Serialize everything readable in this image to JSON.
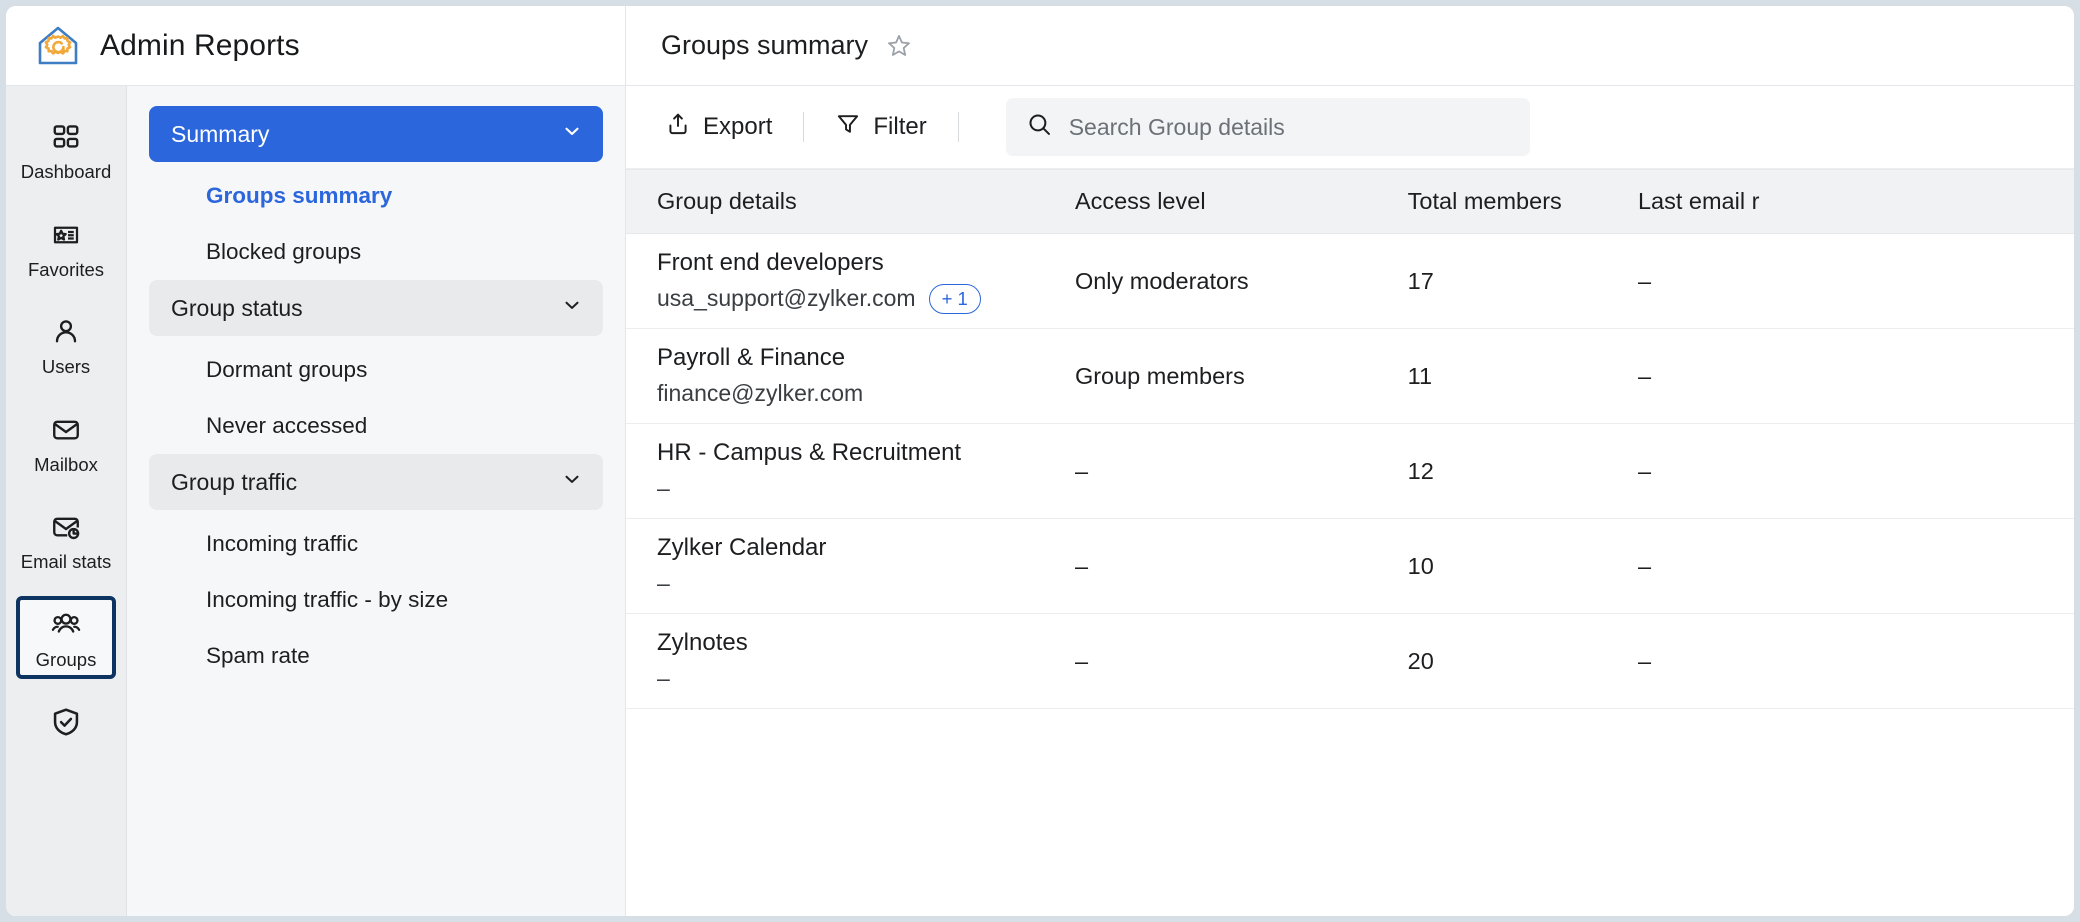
{
  "app": {
    "title": "Admin Reports",
    "logo_icon": "house-gear-icon",
    "brand_blue": "#3C7DC4",
    "brand_orange": "#F2A93B",
    "accent_blue": "#2B66DC",
    "active_rail_border": "#0D3460"
  },
  "page": {
    "title": "Groups summary",
    "favorite_icon": "star-outline-icon"
  },
  "rail": {
    "items": [
      {
        "label": "Dashboard",
        "icon": "grid-squares-icon",
        "active": false
      },
      {
        "label": "Favorites",
        "icon": "star-document-icon",
        "active": false
      },
      {
        "label": "Users",
        "icon": "user-icon",
        "active": false
      },
      {
        "label": "Mailbox",
        "icon": "envelope-icon",
        "active": false
      },
      {
        "label": "Email stats",
        "icon": "envelope-chart-icon",
        "active": false
      },
      {
        "label": "Groups",
        "icon": "group-people-icon",
        "active": true
      },
      {
        "label": "",
        "icon": "shield-check-icon",
        "active": false
      }
    ]
  },
  "subnav": {
    "items": [
      {
        "label": "Summary",
        "type": "group-primary",
        "expanded": true,
        "chevron": "chevron-down-icon"
      },
      {
        "label": "Groups summary",
        "type": "child",
        "active": true
      },
      {
        "label": "Blocked groups",
        "type": "child",
        "active": false
      },
      {
        "label": "Group status",
        "type": "group-shaded",
        "expanded": true,
        "chevron": "chevron-down-icon"
      },
      {
        "label": "Dormant groups",
        "type": "child",
        "active": false
      },
      {
        "label": "Never accessed",
        "type": "child",
        "active": false
      },
      {
        "label": "Group traffic",
        "type": "group-shaded",
        "expanded": true,
        "chevron": "chevron-down-icon"
      },
      {
        "label": "Incoming traffic",
        "type": "child",
        "active": false
      },
      {
        "label": "Incoming traffic - by size",
        "type": "child",
        "active": false
      },
      {
        "label": "Spam rate",
        "type": "child",
        "active": false
      }
    ]
  },
  "toolbar": {
    "export_label": "Export",
    "export_icon": "export-upload-icon",
    "filter_label": "Filter",
    "filter_icon": "funnel-icon",
    "search_placeholder": "Search Group details",
    "search_value": "",
    "search_icon": "search-icon"
  },
  "table": {
    "columns": [
      {
        "key": "group_details",
        "label": "Group details"
      },
      {
        "key": "access_level",
        "label": "Access level"
      },
      {
        "key": "total_members",
        "label": "Total members"
      },
      {
        "key": "last_email",
        "label": "Last email r"
      }
    ],
    "rows": [
      {
        "name": "Front end developers",
        "email": "usa_support@zylker.com",
        "extra_badge": "+ 1",
        "access_level": "Only moderators",
        "total_members": "17",
        "last_email": "–"
      },
      {
        "name": "Payroll & Finance",
        "email": "finance@zylker.com",
        "extra_badge": "",
        "access_level": "Group members",
        "total_members": "11",
        "last_email": "–"
      },
      {
        "name": "HR - Campus & Recruitment",
        "email": "–",
        "extra_badge": "",
        "access_level": "–",
        "total_members": "12",
        "last_email": "–"
      },
      {
        "name": "Zylker Calendar",
        "email": "–",
        "extra_badge": "",
        "access_level": "–",
        "total_members": "10",
        "last_email": "–"
      },
      {
        "name": "Zylnotes",
        "email": "–",
        "extra_badge": "",
        "access_level": "–",
        "total_members": "20",
        "last_email": "–"
      }
    ]
  }
}
